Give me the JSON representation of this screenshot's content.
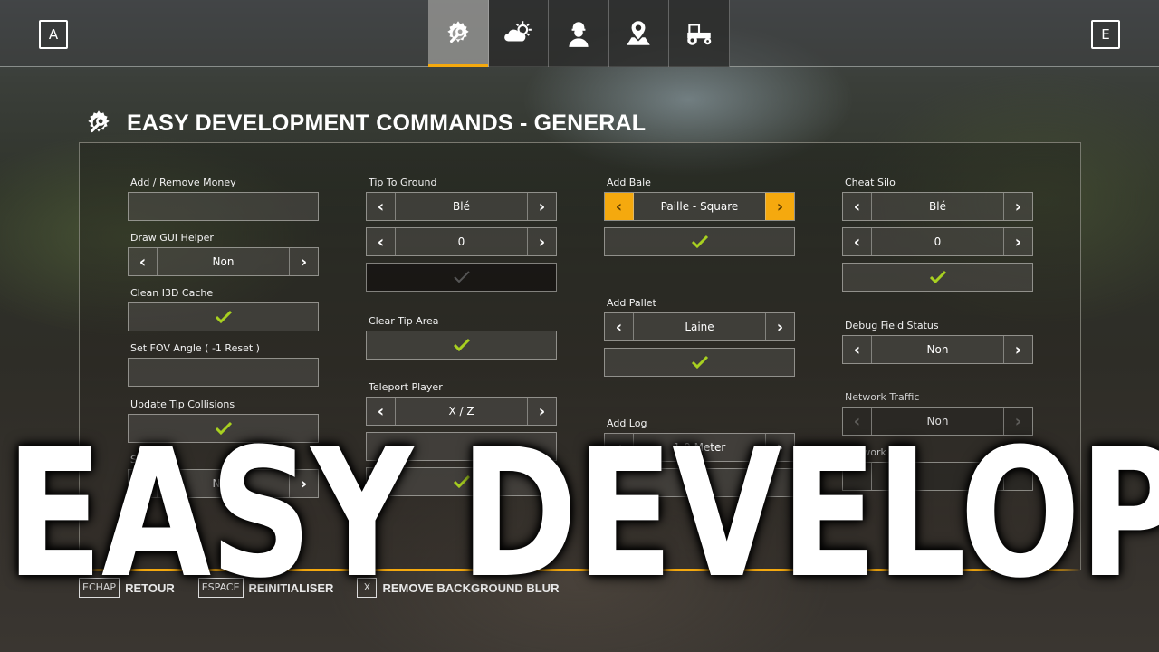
{
  "topbar": {
    "left_key": "A",
    "right_key": "E",
    "tabs": [
      {
        "icon": "wrench-gear-icon",
        "active": true
      },
      {
        "icon": "weather-icon",
        "active": false
      },
      {
        "icon": "player-icon",
        "active": false
      },
      {
        "icon": "map-pin-icon",
        "active": false
      },
      {
        "icon": "tractor-icon",
        "active": false
      }
    ]
  },
  "header": {
    "icon": "wrench-gear-icon",
    "title": "EASY DEVELOPMENT COMMANDS - GENERAL"
  },
  "columns": {
    "col1": {
      "add_money": {
        "label": "Add / Remove Money",
        "value": ""
      },
      "draw_gui": {
        "label": "Draw GUI Helper",
        "value": "Non"
      },
      "clean_i3d": {
        "label": "Clean I3D Cache"
      },
      "set_fov": {
        "label": "Set FOV Angle ( -1 Reset )",
        "value": ""
      },
      "update_tip": {
        "label": "Update Tip Collisions"
      },
      "show_t": {
        "label": "Show T",
        "value": "Non"
      }
    },
    "col2": {
      "tip_to_ground": {
        "label": "Tip To Ground",
        "value": "Blé",
        "amount": "0"
      },
      "clear_tip": {
        "label": "Clear Tip Area"
      },
      "teleport": {
        "label": "Teleport Player",
        "value": "X / Z"
      }
    },
    "col3": {
      "add_bale": {
        "label": "Add Bale",
        "value": "Paille - Square"
      },
      "add_pallet": {
        "label": "Add Pallet",
        "value": "Laine"
      },
      "add_log": {
        "label": "Add Log",
        "value": "1.0 Meter"
      }
    },
    "col4": {
      "cheat_silo": {
        "label": "Cheat Silo",
        "value": "Blé",
        "amount": "0"
      },
      "debug_field": {
        "label": "Debug Field Status",
        "value": "Non"
      },
      "network_traffic": {
        "label": "Network Traffic",
        "value": "Non"
      },
      "network_activity": {
        "label": "Network Activ"
      }
    }
  },
  "footer": {
    "items": [
      {
        "key": "ECHAP",
        "label": "RETOUR"
      },
      {
        "key": "ESPACE",
        "label": "REINITIALISER"
      },
      {
        "key": "X",
        "label": "REMOVE BACKGROUND BLUR"
      }
    ]
  },
  "overlay": {
    "text": "EASY DEVELOPMENT"
  },
  "colors": {
    "accent": "#f5a90e",
    "check": "#a8d020"
  }
}
